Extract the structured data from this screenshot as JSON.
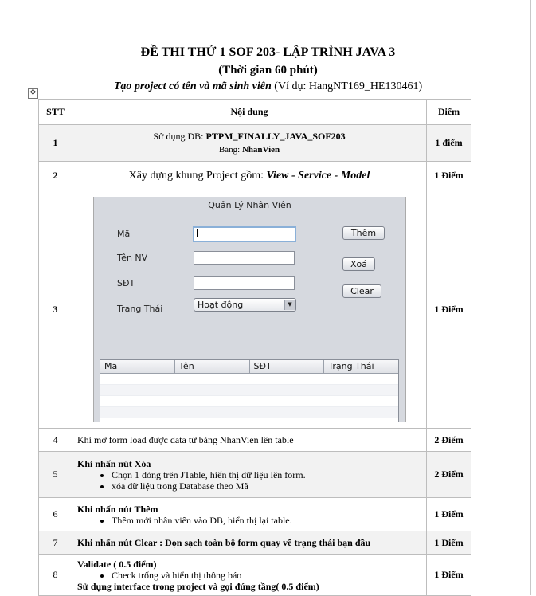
{
  "title_line1": "ĐỀ THI THỬ 1 SOF 203- LẬP TRÌNH JAVA 3",
  "title_line2": "(Thời gian 60  phút)",
  "title_line3_bold": "Tạo project có tên và mã sinh viên",
  "title_line3_rest": " (Ví dụ: HangNT169_HE130461)",
  "move_handle_icon": "move-cross-icon",
  "table": {
    "headers": [
      "STT",
      "Nội dung",
      "Điểm"
    ],
    "row1": {
      "stt": "1",
      "line1_prefix": "Sử dụng DB: ",
      "line1_bold": "PTPM_FINALLY_JAVA_SOF203",
      "line2_prefix": "Bảng: ",
      "line2_bold": "NhanVien",
      "score": "1 điểm"
    },
    "row2": {
      "stt": "2",
      "prefix": "Xây dựng khung Project gồm: ",
      "bold": "View - Service - Model",
      "score": "1 Điểm"
    },
    "row3": {
      "stt": "3",
      "score": "1 Điểm"
    },
    "row4": {
      "stt": "4",
      "text": "Khi mở form load được data từ bảng NhanVien lên table",
      "score": "2 Điểm"
    },
    "row5": {
      "stt": "5",
      "title": "Khi nhấn nút Xóa",
      "bullets": [
        "Chọn 1 dòng trên JTable, hiển thị dữ liệu lên form.",
        "xóa dữ liệu trong Database theo Mã"
      ],
      "score": "2 Điểm"
    },
    "row6": {
      "stt": "6",
      "title": "Khi nhấn nút Thêm",
      "bullets": [
        "Thêm mới nhân viên vào DB, hiển thị lại table."
      ],
      "score": "1 Điểm"
    },
    "row7": {
      "stt": "7",
      "text": "Khi nhấn nút Clear : Dọn sạch toàn bộ form quay về trạng thái bạn đầu",
      "score": "1 Điểm"
    },
    "row8": {
      "stt": "8",
      "title": "Validate ( 0.5 điểm)",
      "bullets": [
        "Check trống và hiển thị thông báo"
      ],
      "footer": "Sử dụng interface trong project và gọi đúng tầng( 0.5 điểm)",
      "score": "1 Điểm"
    }
  },
  "form": {
    "title": "Quản Lý Nhân Viên",
    "labels": {
      "ma": "Mã",
      "ten": "Tên NV",
      "sdt": "SĐT",
      "trang_thai": "Trạng Thái"
    },
    "values": {
      "ma": "",
      "ten": "",
      "sdt": ""
    },
    "combo_value": "Hoạt động",
    "buttons": {
      "them": "Thêm",
      "xoa": "Xoá",
      "clear": "Clear"
    },
    "columns": [
      "Mã",
      "Tên",
      "SĐT",
      "Trạng Thái"
    ]
  }
}
